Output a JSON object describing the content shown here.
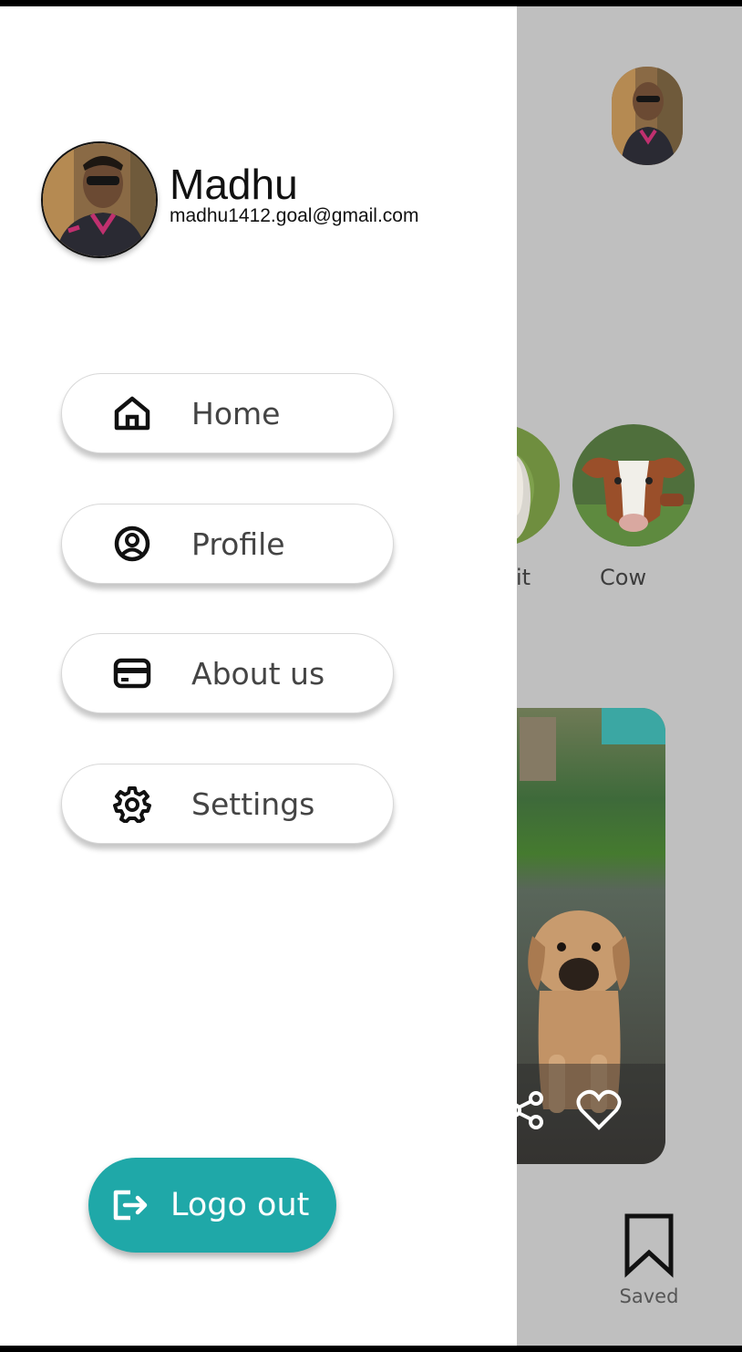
{
  "drawer": {
    "user": {
      "name": "Madhu",
      "email": "madhu1412.goal@gmail.com"
    },
    "menu": [
      {
        "label": "Home",
        "icon": "home-icon"
      },
      {
        "label": "Profile",
        "icon": "user-circle-icon"
      },
      {
        "label": "About us",
        "icon": "card-icon"
      },
      {
        "label": "Settings",
        "icon": "gear-icon"
      }
    ],
    "logout_label": "Logo out",
    "accent_color": "#1fa8a8"
  },
  "background": {
    "categories": [
      {
        "label": "it"
      },
      {
        "label": "Cow"
      }
    ],
    "nav": {
      "saved_label": "Saved"
    },
    "overlay_color": "#bfbfbf"
  }
}
